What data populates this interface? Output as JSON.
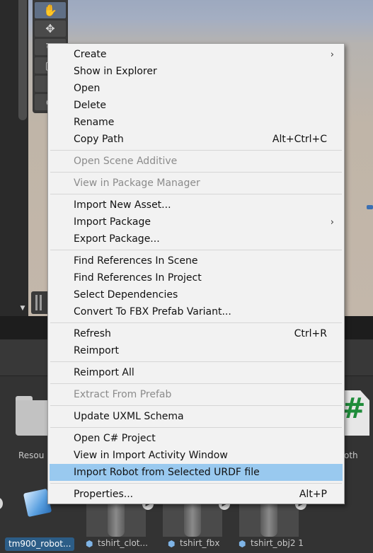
{
  "toolbar": {
    "tools": [
      {
        "icon": "hand-icon",
        "glyph": "✋"
      },
      {
        "icon": "move-icon",
        "glyph": "✥"
      },
      {
        "icon": "rotate-icon",
        "glyph": "↻"
      },
      {
        "icon": "scale-icon",
        "glyph": "▢"
      },
      {
        "icon": "rect-icon",
        "glyph": "⌶"
      },
      {
        "icon": "transform-icon",
        "glyph": "⊘"
      }
    ]
  },
  "context_menu": {
    "items": [
      {
        "label": "Create",
        "submenu": true
      },
      {
        "label": "Show in Explorer"
      },
      {
        "label": "Open"
      },
      {
        "label": "Delete"
      },
      {
        "label": "Rename"
      },
      {
        "label": "Copy Path",
        "shortcut": "Alt+Ctrl+C"
      },
      {
        "label": "Open Scene Additive",
        "disabled": true
      },
      {
        "label": "View in Package Manager",
        "disabled": true
      },
      {
        "label": "Import New Asset..."
      },
      {
        "label": "Import Package",
        "submenu": true
      },
      {
        "label": "Export Package..."
      },
      {
        "label": "Find References In Scene"
      },
      {
        "label": "Find References In Project"
      },
      {
        "label": "Select Dependencies"
      },
      {
        "label": "Convert To FBX Prefab Variant..."
      },
      {
        "label": "Refresh",
        "shortcut": "Ctrl+R"
      },
      {
        "label": "Reimport"
      },
      {
        "label": "Reimport All"
      },
      {
        "label": "Extract From Prefab",
        "disabled": true
      },
      {
        "label": "Update UXML Schema"
      },
      {
        "label": "Open C# Project"
      },
      {
        "label": "View in Import Activity Window"
      },
      {
        "label": "Import Robot from Selected URDF file",
        "highlighted": true
      },
      {
        "label": "Properties...",
        "shortcut": "Alt+P"
      }
    ],
    "submenu_arrow": "›"
  },
  "project": {
    "folder_label": "Resou",
    "script_label": "oth",
    "script_glyph": "#",
    "assets": [
      {
        "label": "tm900_robot...",
        "selected": true
      },
      {
        "label": "tshirt_clot..."
      },
      {
        "label": "tshirt_fbx"
      },
      {
        "label": "tshirt_obj2 1"
      }
    ]
  },
  "colors": {
    "menu_highlight": "#99c9ef",
    "selection": "#2c5d87",
    "script_icon": "#1f8c3a"
  }
}
